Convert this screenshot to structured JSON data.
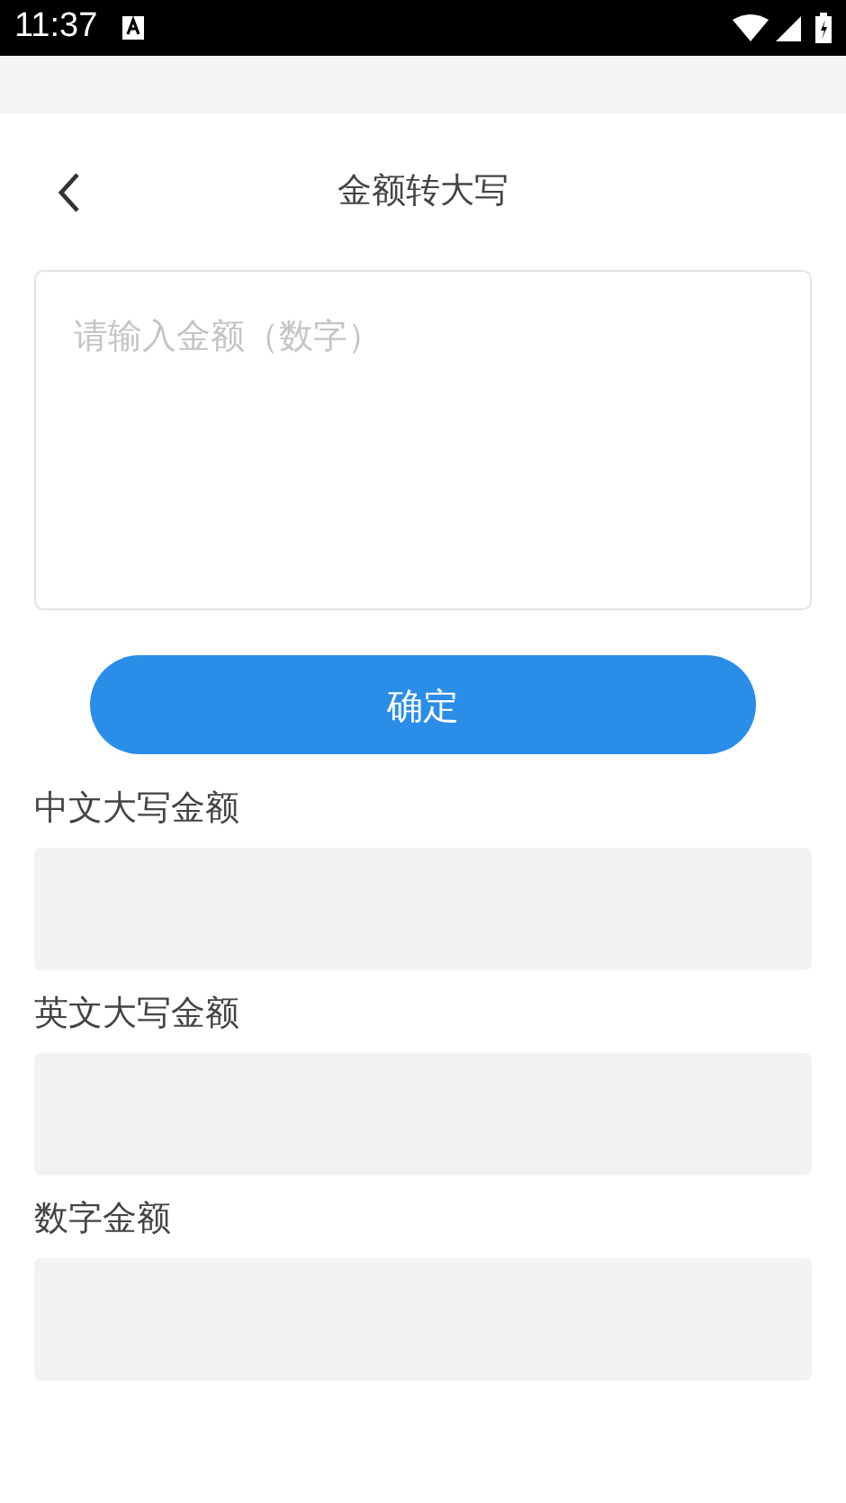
{
  "status_bar": {
    "time": "11:37"
  },
  "header": {
    "title": "金额转大写"
  },
  "amount_input": {
    "placeholder": "请输入金额（数字）"
  },
  "confirm_button": {
    "label": "确定"
  },
  "results": [
    {
      "label": "中文大写金额"
    },
    {
      "label": "英文大写金额"
    },
    {
      "label": "数字金额"
    }
  ]
}
